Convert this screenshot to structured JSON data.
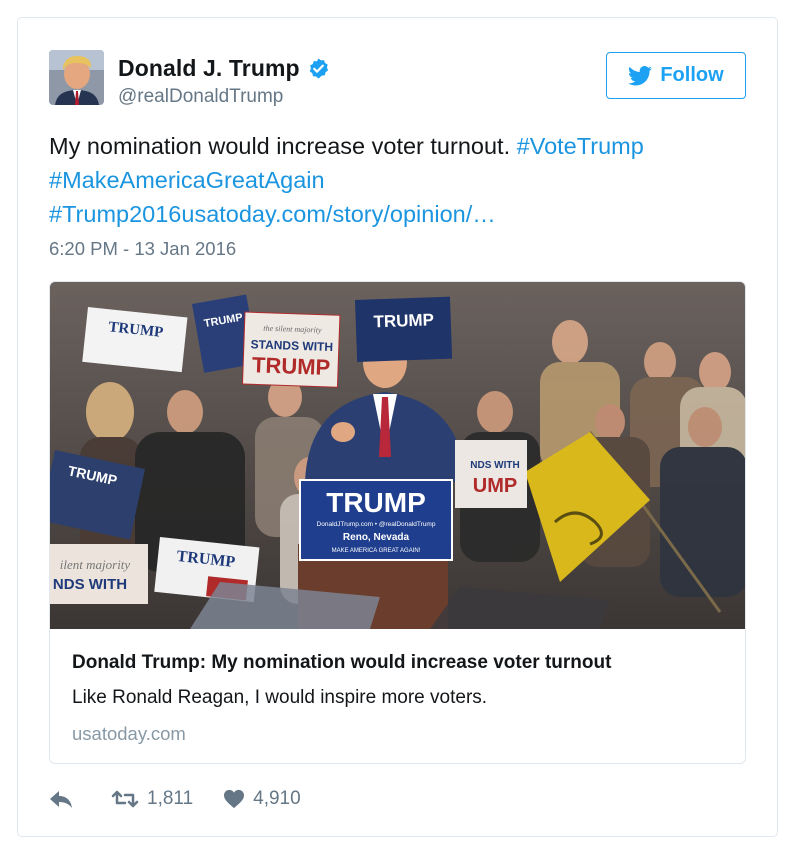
{
  "user": {
    "name": "Donald J. Trump",
    "handle": "@realDonaldTrump",
    "verified": true
  },
  "follow_button": {
    "label": "Follow",
    "icon": "twitter-bird-icon"
  },
  "tweet": {
    "text_plain": "My nomination would increase voter turnout.",
    "hashtag_1": "#VoteTrump",
    "hashtag_2": "#MakeAmericaGreatAgain",
    "hashtag_3": "#Trump2016",
    "link": "usatoday.com/story/opinion/…",
    "timestamp": "6:20 PM - 13 Jan 2016"
  },
  "card": {
    "title": "Donald Trump: My nomination would increase voter turnout",
    "description": "Like Ronald Reagan, I would inspire more voters.",
    "domain": "usatoday.com",
    "image": {
      "sign_main": "TRUMP",
      "sign_main_url": "DonaldJTrump.com • @realDonaldTrump",
      "sign_main_city": "Reno, Nevada",
      "sign_main_slogan": "MAKE AMERICA GREAT AGAIN!",
      "sign_stands_line1": "the silent majority",
      "sign_stands_line2": "STANDS WITH",
      "sign_stands_line3": "TRUMP",
      "sign_right_line1": "NDS WITH",
      "sign_right_line2": "UMP",
      "sign_left_line1": "ilent majority",
      "sign_left_line2": "NDS WITH",
      "sign_trump_a": "TRUMP",
      "sign_trump_b": "TRUMP",
      "sign_trump_c": "TRUMP",
      "sign_trump_d": "TRUMP",
      "sign_trump_e": "TRUMP"
    }
  },
  "actions": {
    "reply_icon": "reply-icon",
    "retweet_icon": "retweet-icon",
    "retweets": "1,811",
    "like_icon": "heart-icon",
    "likes": "4,910"
  },
  "colors": {
    "twitter_blue": "#1da1f2",
    "link_blue": "#1b95e0",
    "gray_text": "#657786",
    "border": "#e1e8ed"
  }
}
